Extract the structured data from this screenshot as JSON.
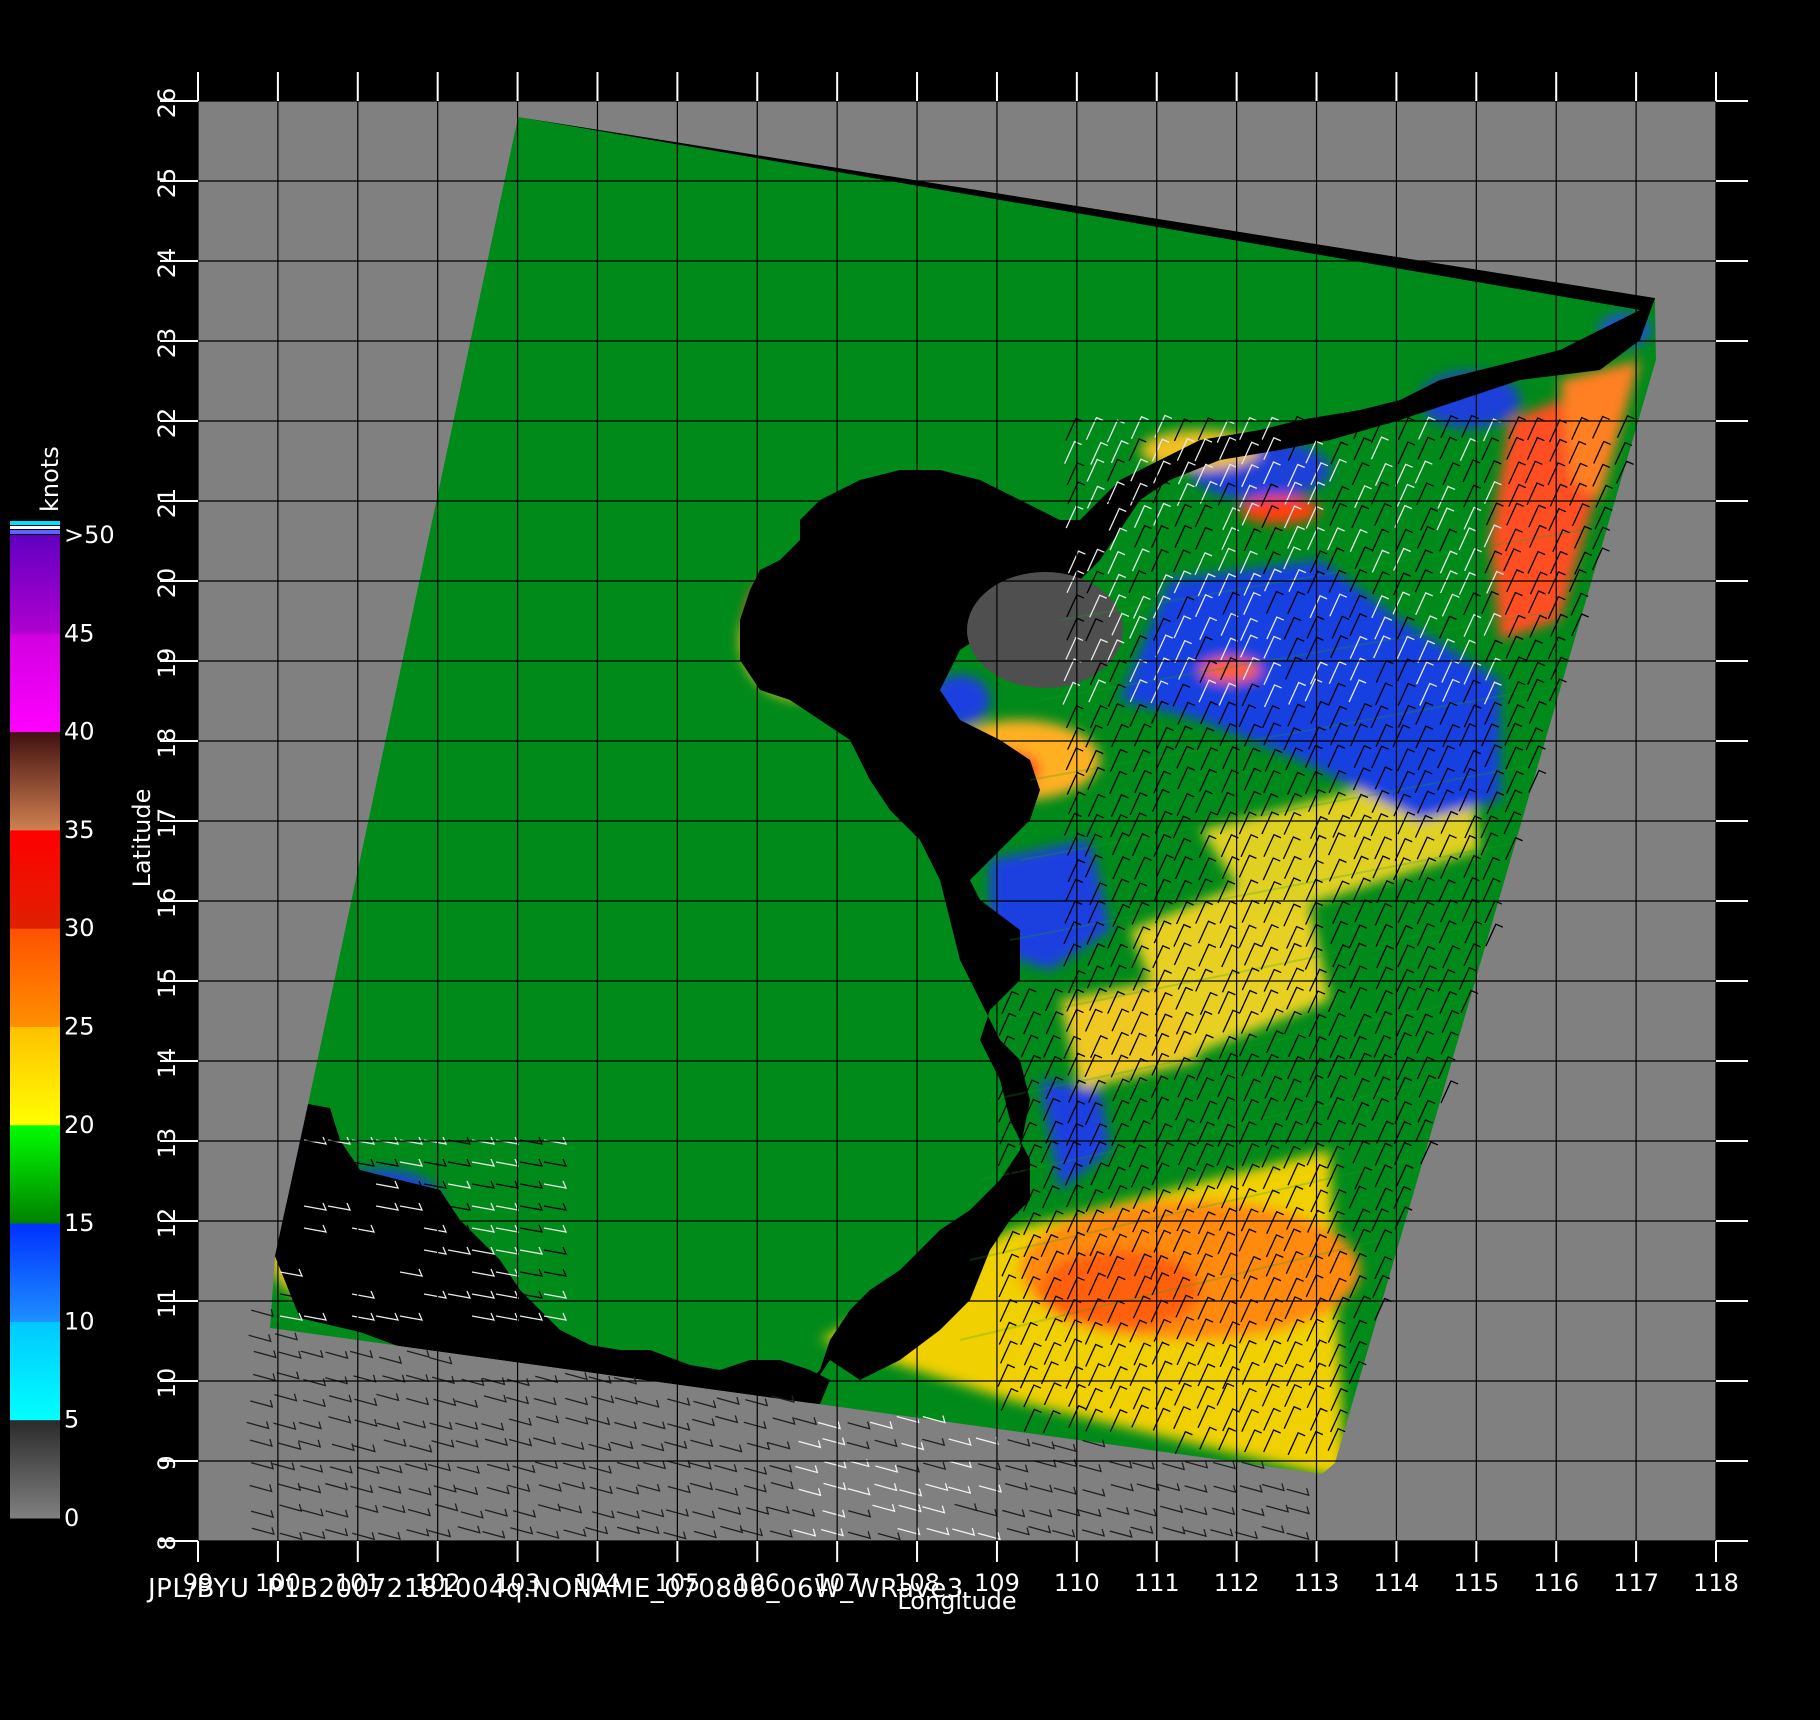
{
  "footer": "JPL/BYU  P1B20072181004q.NONAME_070806_06W_WRave3",
  "axes": {
    "x": {
      "label": "Longitude",
      "ticks": [
        "99",
        "100",
        "101",
        "102",
        "103",
        "104",
        "105",
        "106",
        "107",
        "108",
        "109",
        "110",
        "111",
        "112",
        "113",
        "114",
        "115",
        "116",
        "117",
        "118"
      ]
    },
    "y": {
      "label": "Latitude",
      "ticks": [
        "8",
        "9",
        "10",
        "11",
        "12",
        "13",
        "14",
        "15",
        "16",
        "17",
        "18",
        "19",
        "20",
        "21",
        "22",
        "23",
        "24",
        "25",
        "26"
      ]
    }
  },
  "colorbar": {
    "unit": "knots",
    "tick_labels": [
      "0",
      "5",
      "10",
      "15",
      "20",
      "25",
      "30",
      "35",
      "40",
      "45",
      ">50"
    ],
    "bands": [
      {
        "from": 0,
        "to": 5,
        "colors": [
          "#808080",
          "#2a2a2a"
        ]
      },
      {
        "from": 5,
        "to": 10,
        "colors": [
          "#00ffff",
          "#00c8ff"
        ]
      },
      {
        "from": 10,
        "to": 15,
        "colors": [
          "#1e90ff",
          "#0030ff"
        ]
      },
      {
        "from": 15,
        "to": 20,
        "colors": [
          "#008000",
          "#00ff00"
        ]
      },
      {
        "from": 20,
        "to": 25,
        "colors": [
          "#ffff00",
          "#ffc000"
        ]
      },
      {
        "from": 25,
        "to": 30,
        "colors": [
          "#ff9000",
          "#ff5000"
        ]
      },
      {
        "from": 30,
        "to": 35,
        "colors": [
          "#e02000",
          "#ff0000"
        ]
      },
      {
        "from": 35,
        "to": 40,
        "colors": [
          "#d08050",
          "#401010"
        ]
      },
      {
        "from": 40,
        "to": 45,
        "colors": [
          "#ff00ff",
          "#d000e0"
        ]
      },
      {
        "from": 45,
        "to": 50,
        "colors": [
          "#b000d0",
          "#6000c0"
        ]
      }
    ]
  },
  "colors": {
    "background": "#000000",
    "no_data": "#808080",
    "land": "#4f4f4f",
    "grid": "#000000",
    "text": "#ffffff"
  }
}
